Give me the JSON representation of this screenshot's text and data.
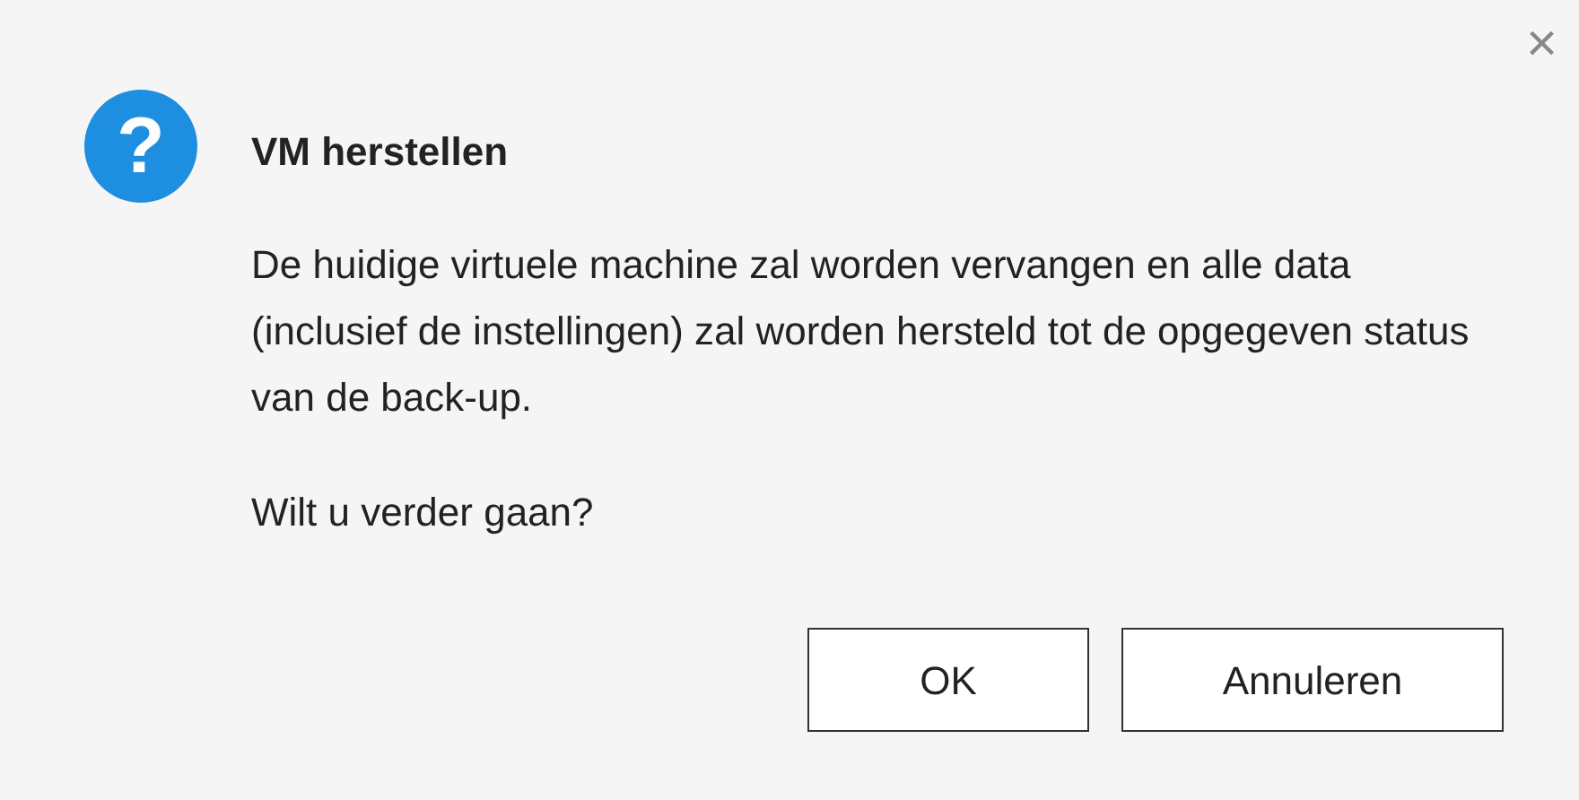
{
  "dialog": {
    "title": "VM herstellen",
    "message": "De huidige virtuele machine zal worden vervangen en alle data (inclusief de instellingen) zal worden hersteld tot de opgegeven status van de back-up.",
    "question": "Wilt u verder gaan?",
    "close": "×",
    "icon": "?",
    "buttons": [
      "OK",
      "Annuleren"
    ]
  }
}
